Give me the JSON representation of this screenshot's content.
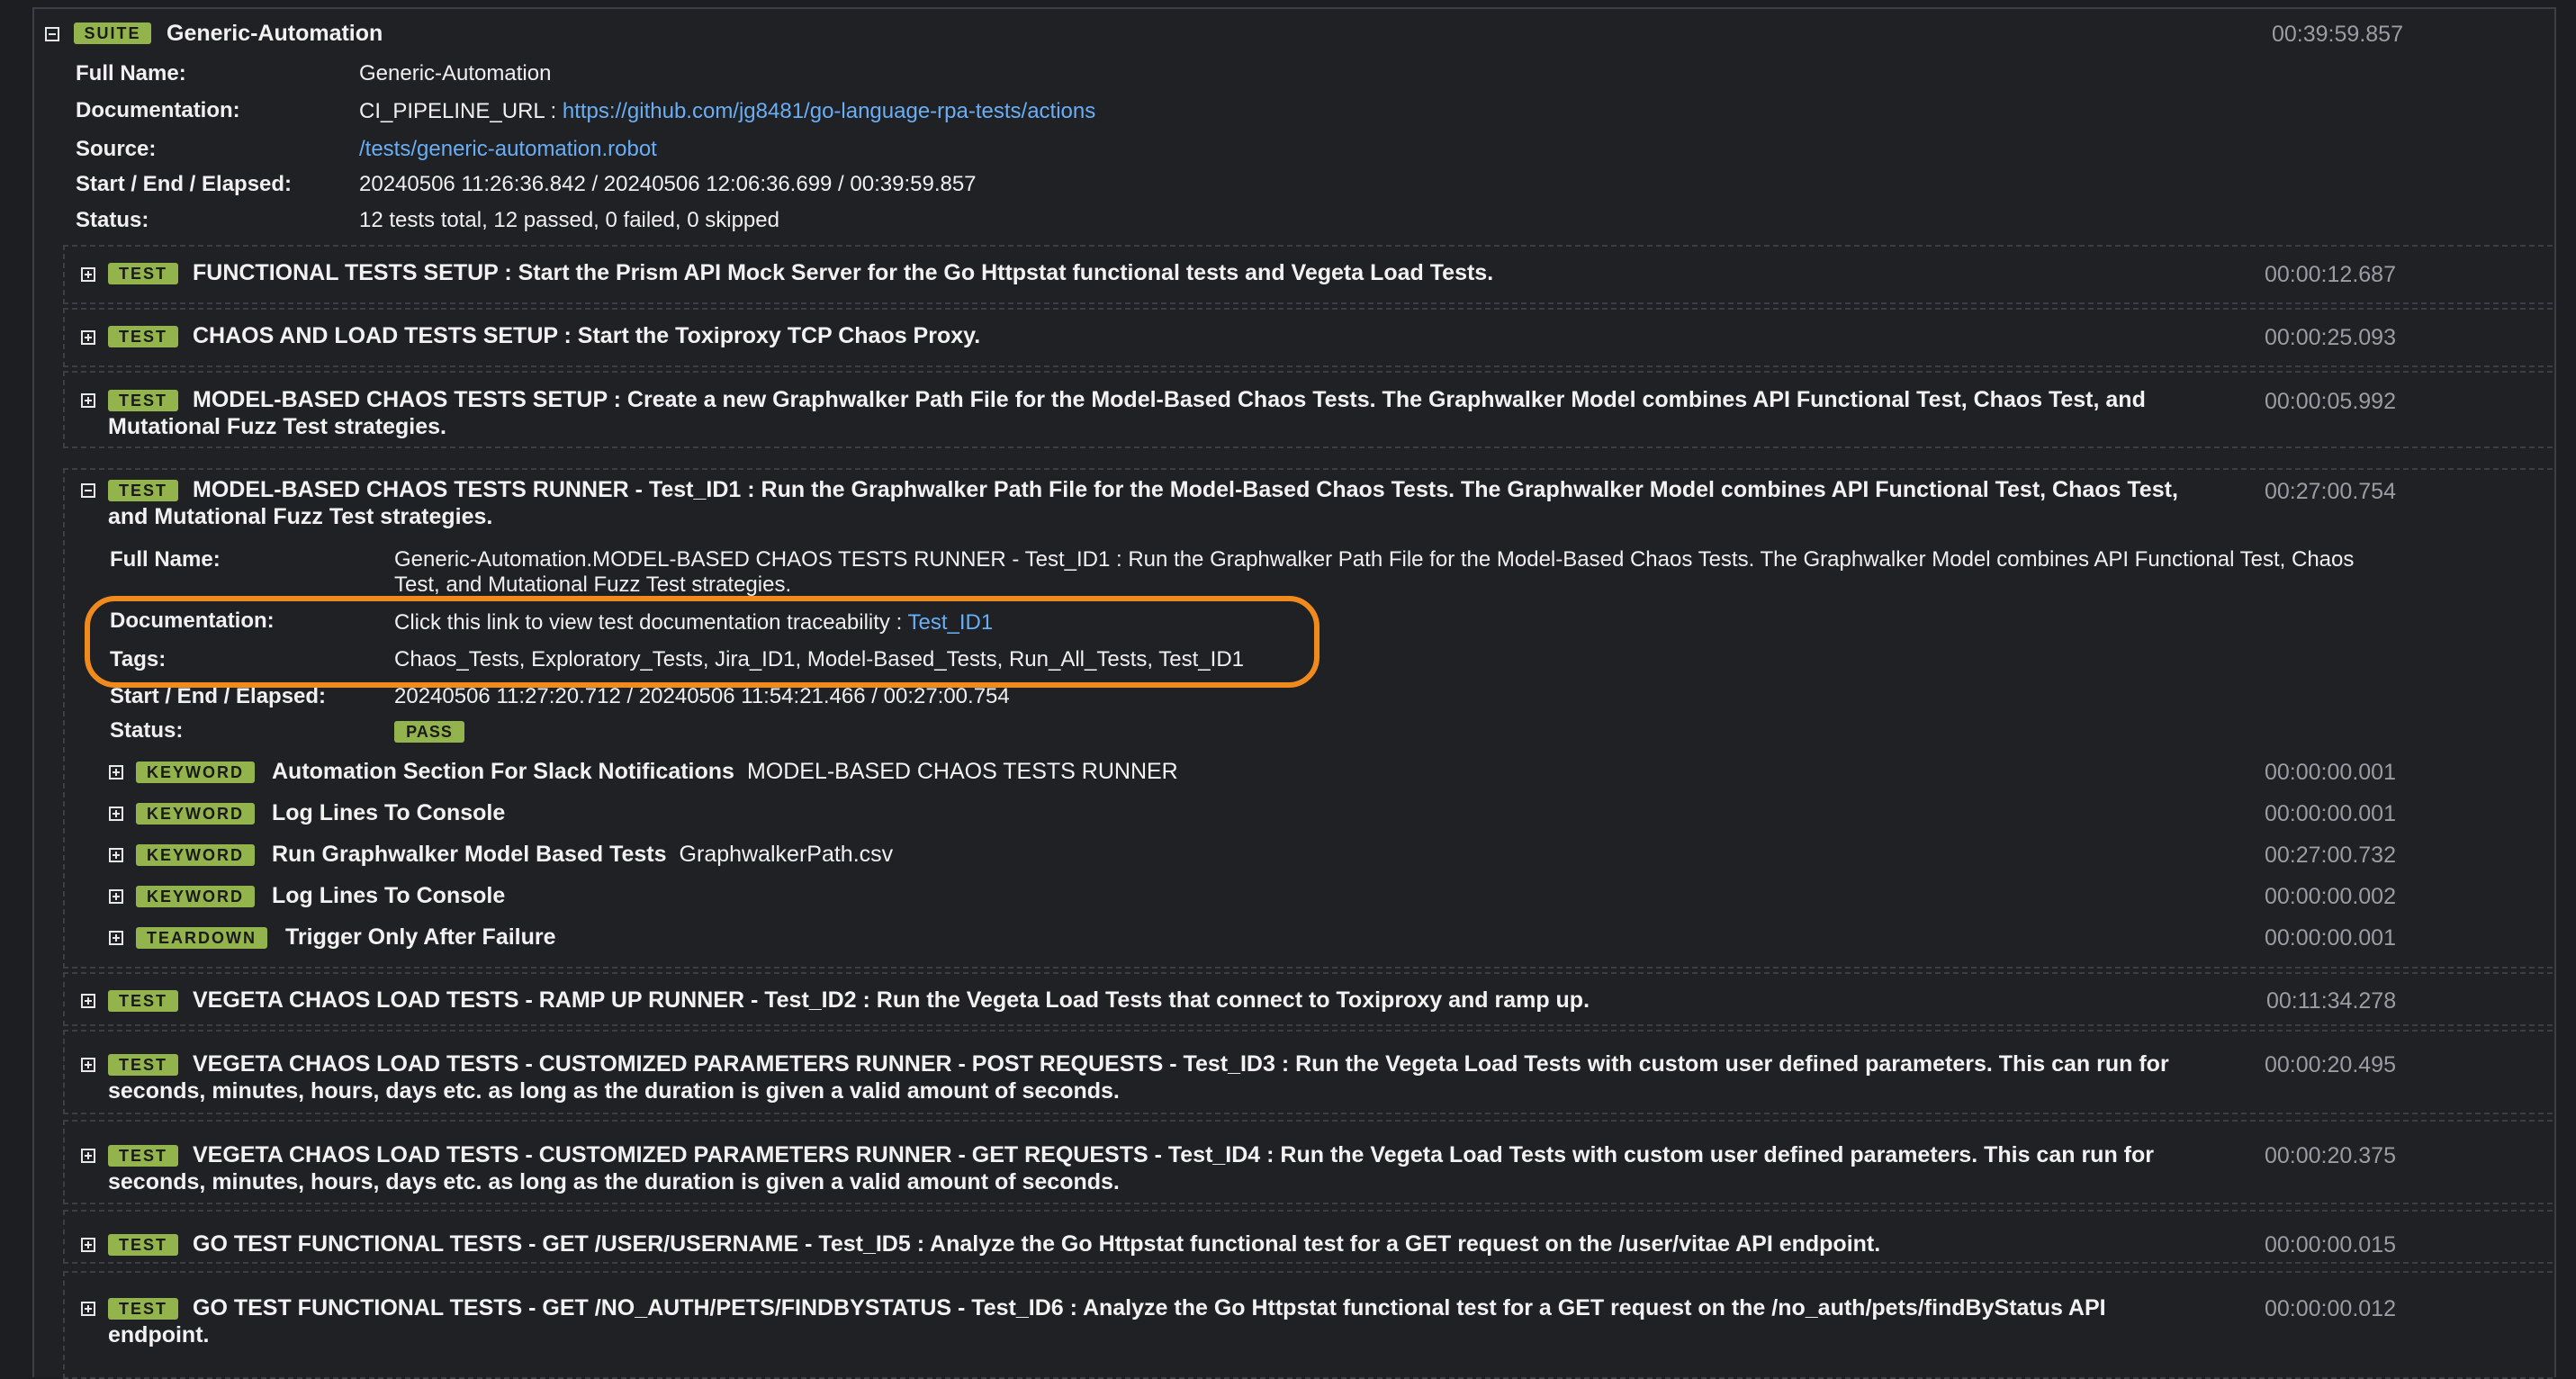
{
  "suite": {
    "badge": "SUITE",
    "name": "Generic-Automation",
    "elapsed": "00:39:59.857",
    "labels": {
      "full_name": "Full Name:",
      "documentation": "Documentation:",
      "source": "Source:",
      "start_end": "Start / End / Elapsed:",
      "status": "Status:"
    },
    "full_name": "Generic-Automation",
    "doc_prefix": "CI_PIPELINE_URL :",
    "doc_link": "https://github.com/jg8481/go-language-rpa-tests/actions",
    "source": "/tests/generic-automation.robot",
    "start_end": "20240506 11:26:36.842 / 20240506 12:06:36.699 / 00:39:59.857",
    "status": "12 tests total, 12 passed, 0 failed, 0 skipped"
  },
  "tests": [
    {
      "badge": "TEST",
      "line1": "FUNCTIONAL TESTS SETUP : Start the Prism API Mock Server for the Go Httpstat functional tests and Vegeta Load Tests.",
      "line2": "",
      "elapsed": "00:00:12.687"
    },
    {
      "badge": "TEST",
      "line1": "CHAOS AND LOAD TESTS SETUP : Start the Toxiproxy TCP Chaos Proxy.",
      "line2": "",
      "elapsed": "00:00:25.093"
    },
    {
      "badge": "TEST",
      "line1": "MODEL-BASED CHAOS TESTS SETUP : Create a new Graphwalker Path File for the Model-Based Chaos Tests. The Graphwalker Model combines API Functional Test, Chaos Test, and",
      "line2": "Mutational Fuzz Test strategies.",
      "elapsed": "00:00:05.992"
    },
    {
      "badge": "TEST",
      "line1": "MODEL-BASED CHAOS TESTS RUNNER - Test_ID1 : Run the Graphwalker Path File for the Model-Based Chaos Tests. The Graphwalker Model combines API Functional Test, Chaos Test,",
      "line2": "and Mutational Fuzz Test strategies.",
      "elapsed": "00:27:00.754"
    },
    {
      "badge": "TEST",
      "line1": "VEGETA CHAOS LOAD TESTS - RAMP UP RUNNER - Test_ID2 : Run the Vegeta Load Tests that connect to Toxiproxy and ramp up.",
      "line2": "",
      "elapsed": "00:11:34.278"
    },
    {
      "badge": "TEST",
      "line1": "VEGETA CHAOS LOAD TESTS - CUSTOMIZED PARAMETERS RUNNER - POST REQUESTS - Test_ID3 : Run the Vegeta Load Tests with custom user defined parameters. This can run for",
      "line2": "seconds, minutes, hours, days etc. as long as the duration is given a valid amount of seconds.",
      "elapsed": "00:00:20.495"
    },
    {
      "badge": "TEST",
      "line1": "VEGETA CHAOS LOAD TESTS - CUSTOMIZED PARAMETERS RUNNER - GET REQUESTS - Test_ID4 : Run the Vegeta Load Tests with custom user defined parameters. This can run for",
      "line2": "seconds, minutes, hours, days etc. as long as the duration is given a valid amount of seconds.",
      "elapsed": "00:00:20.375"
    },
    {
      "badge": "TEST",
      "line1": "GO TEST FUNCTIONAL TESTS - GET /USER/USERNAME - Test_ID5 : Analyze the Go Httpstat functional test for a GET request on the /user/vitae API endpoint.",
      "line2": "",
      "elapsed": "00:00:00.015"
    },
    {
      "badge": "TEST",
      "line1": "GO TEST FUNCTIONAL TESTS - GET /NO_AUTH/PETS/FINDBYSTATUS - Test_ID6 : Analyze the Go Httpstat functional test for a GET request on the /no_auth/pets/findByStatus API",
      "line2": "endpoint.",
      "elapsed": "00:00:00.012"
    }
  ],
  "expanded": {
    "labels": {
      "full_name": "Full Name:",
      "documentation": "Documentation:",
      "tags": "Tags:",
      "start_end": "Start / End / Elapsed:",
      "status": "Status:"
    },
    "full_name_line1": "Generic-Automation.MODEL-BASED CHAOS TESTS RUNNER - Test_ID1 : Run the Graphwalker Path File for the Model-Based Chaos Tests. The Graphwalker Model combines API Functional Test, Chaos",
    "full_name_line2": "Test, and Mutational Fuzz Test strategies.",
    "doc_prefix": "Click this link to view test documentation traceability :",
    "doc_link": "Test_ID1",
    "tags": "Chaos_Tests, Exploratory_Tests, Jira_ID1, Model-Based_Tests, Run_All_Tests, Test_ID1",
    "start_end": "20240506 11:27:20.712 / 20240506 11:54:21.466 / 00:27:00.754",
    "status_badge": "PASS",
    "keywords": [
      {
        "badge": "KEYWORD",
        "name": "Automation Section For Slack Notifications",
        "arg": "MODEL-BASED CHAOS TESTS RUNNER",
        "elapsed": "00:00:00.001"
      },
      {
        "badge": "KEYWORD",
        "name": "Log Lines To Console",
        "arg": "",
        "elapsed": "00:00:00.001"
      },
      {
        "badge": "KEYWORD",
        "name": "Run Graphwalker Model Based Tests",
        "arg": "GraphwalkerPath.csv",
        "elapsed": "00:27:00.732"
      },
      {
        "badge": "KEYWORD",
        "name": "Log Lines To Console",
        "arg": "",
        "elapsed": "00:00:00.002"
      },
      {
        "badge": "TEARDOWN",
        "name": "Trigger Only After Failure",
        "arg": "",
        "elapsed": "00:00:00.001"
      }
    ]
  },
  "colors": {
    "background": "#1c1e21",
    "badge": "#93b44c",
    "link": "#6aaef5",
    "highlight": "#f08a1c"
  }
}
